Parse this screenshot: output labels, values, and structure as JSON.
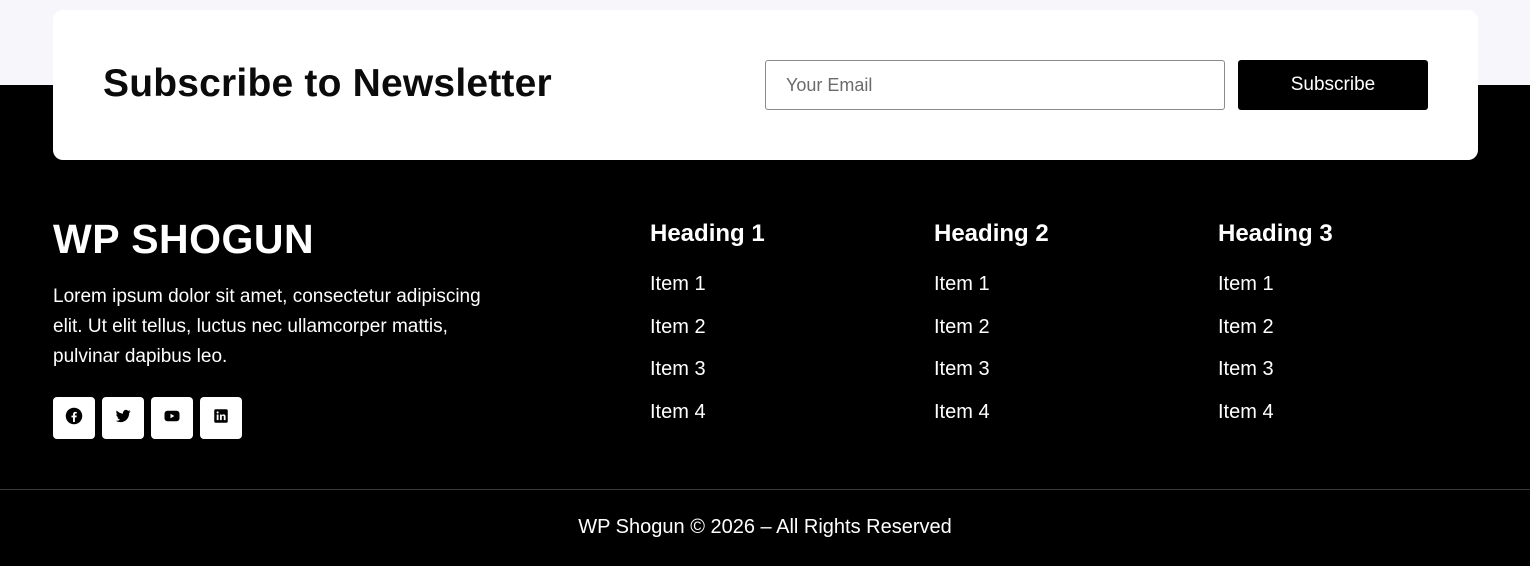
{
  "newsletter": {
    "title": "Subscribe to Newsletter",
    "email_placeholder": "Your Email",
    "email_value": "",
    "button_label": "Subscribe"
  },
  "brand": {
    "name": "WP SHOGUN",
    "description": "Lorem ipsum dolor sit amet, consectetur adipiscing elit. Ut elit tellus, luctus nec ullamcorper mattis, pulvinar dapibus leo."
  },
  "socials": [
    {
      "icon": "facebook-icon"
    },
    {
      "icon": "twitter-icon"
    },
    {
      "icon": "youtube-icon"
    },
    {
      "icon": "linkedin-icon"
    }
  ],
  "columns": [
    {
      "heading": "Heading 1",
      "items": [
        "Item 1",
        "Item 2",
        "Item 3",
        "Item 4"
      ]
    },
    {
      "heading": "Heading 2",
      "items": [
        "Item 1",
        "Item 2",
        "Item 3",
        "Item 4"
      ]
    },
    {
      "heading": "Heading 3",
      "items": [
        "Item 1",
        "Item 2",
        "Item 3",
        "Item 4"
      ]
    }
  ],
  "footer": {
    "copyright": "WP Shogun © 2026 – All Rights Reserved"
  },
  "colors": {
    "background": "#000000",
    "top_band": "#f6f6fb",
    "card": "#ffffff",
    "text": "#ffffff"
  }
}
